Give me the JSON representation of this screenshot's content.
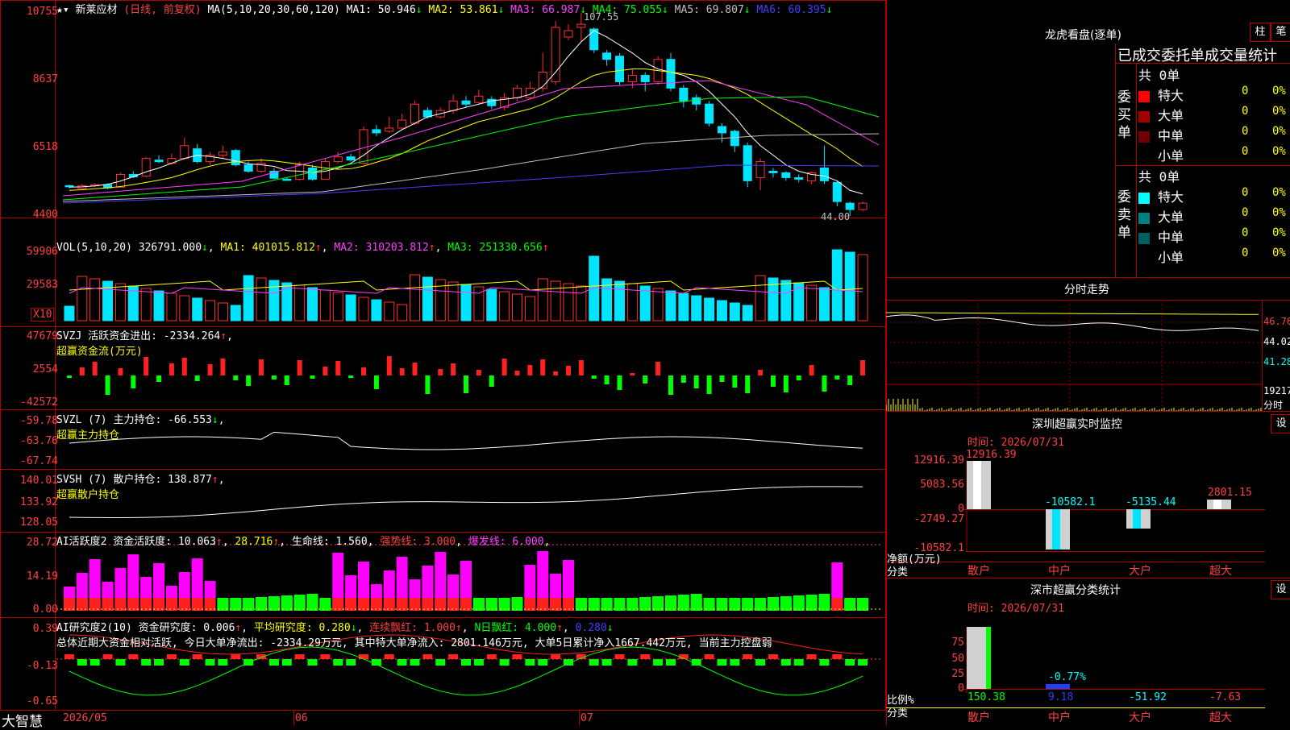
{
  "header": {
    "stock_name": "新莱应材",
    "period": "(日线, 前复权)",
    "ma_params": "MA(5,10,20,30,60,120)",
    "ma": [
      {
        "label": "MA1:",
        "value": "50.946",
        "arrow": "↓",
        "color": "#ffffff"
      },
      {
        "label": "MA2:",
        "value": "53.861",
        "arrow": "↓",
        "color": "#ffff00"
      },
      {
        "label": "MA3:",
        "value": "66.987",
        "arrow": "↓",
        "color": "#ff40ff"
      },
      {
        "label": "MA4:",
        "value": "75.055",
        "arrow": "↓",
        "color": "#00ff00"
      },
      {
        "label": "MA5:",
        "value": "69.807",
        "arrow": "↓",
        "color": "#c0c0c0"
      },
      {
        "label": "MA6:",
        "value": "60.395",
        "arrow": "↓",
        "color": "#4040ff"
      }
    ],
    "high_mark": "107.55",
    "low_mark": "44.00",
    "y_axis": [
      "10755",
      "8637",
      "6518",
      "4400"
    ]
  },
  "vol": {
    "title": "VOL(5,10,20)",
    "value": "326791.000",
    "ma1": "MA1: 401015.812",
    "ma2": "MA2: 310203.812",
    "ma3": "MA3: 251330.656",
    "y_axis": [
      "59906",
      "29583"
    ],
    "unit": "X10"
  },
  "svzj": {
    "title": "SVZJ  活跃资金进出: -2334.264",
    "subtitle": "超赢资金流(万元)",
    "y_axis": [
      "47679",
      "2554",
      "-42572"
    ]
  },
  "svzl": {
    "title": "SVZL (7) 主力持仓: -66.553",
    "subtitle": "超赢主力持仓",
    "y_axis": [
      "-59.78",
      "-63.76",
      "-67.74"
    ]
  },
  "svsh": {
    "title": "SVSH (7) 散户持仓: 138.877",
    "subtitle": "超赢散户持仓",
    "y_axis": [
      "140.01",
      "133.92",
      "128.05"
    ]
  },
  "ai_active": {
    "title": "AI活跃度2 资金活跃度: 10.063",
    "v2": "28.716",
    "life": "生命线: 1.560",
    "strong": "强势线: 3.000",
    "burst": "爆发线: 6.000",
    "y_axis": [
      "28.72",
      "14.19",
      "0.00"
    ]
  },
  "ai_research": {
    "title": "AI研究度2(10) 资金研究度: 0.006",
    "avg": "平均研究度: 0.280",
    "cont": "连续飘红: 1.000",
    "nday": "N日飘红: 4.000",
    "last": "0.280",
    "summary": "总体近期大资金相对活跃, 今日大单净流出: -2334.29万元, 其中特大单净流入: 2801.146万元, 大单5日累计净入1667.442万元, 当前主力控盘弱",
    "y_axis": [
      "0.39",
      "-0.13",
      "-0.65"
    ]
  },
  "bottom_axis": {
    "brand": "大智慧",
    "d1": "2026/05",
    "d2": "06",
    "d3": "07"
  },
  "right": {
    "top_title": "龙虎看盘(逐单)",
    "btn_bar": "柱",
    "btn_pen": "笔",
    "stat_title": "已成交委托单成交量统计",
    "buy_label": "委买单",
    "sell_label": "委卖单",
    "buy_total": "共 0单",
    "sell_total": "共 0单",
    "buy_rows": [
      {
        "name": "特大",
        "count": "0",
        "pct": "0%",
        "color": "#ff0000"
      },
      {
        "name": "大单",
        "count": "0",
        "pct": "0%",
        "color": "#a00000"
      },
      {
        "name": "中单",
        "count": "0",
        "pct": "0%",
        "color": "#700000"
      },
      {
        "name": "小单",
        "count": "0",
        "pct": "0%",
        "color": ""
      }
    ],
    "sell_rows": [
      {
        "name": "特大",
        "count": "0",
        "pct": "0%",
        "color": "#00ffff"
      },
      {
        "name": "大单",
        "count": "0",
        "pct": "0%",
        "color": "#008080"
      },
      {
        "name": "中单",
        "count": "0",
        "pct": "0%",
        "color": "#006060"
      },
      {
        "name": "小单",
        "count": "0",
        "pct": "0%",
        "color": ""
      }
    ],
    "intraday_title": "分时走势",
    "intraday_labels": [
      "46.76",
      "44.02",
      "41.28",
      "19217",
      "分时"
    ],
    "sz_title": "深圳超赢实时监控",
    "sz_time": "时间: 2026/07/31",
    "sz_y": [
      "12916.39",
      "5083.56",
      "0",
      "-2749.27",
      "-10582.1"
    ],
    "sz_values": [
      "12916.39",
      "-10582.1",
      "-5135.44",
      "2801.15"
    ],
    "sz_unit": "净额(万元)",
    "sz_cat": "分类",
    "categories": [
      "散户",
      "中户",
      "大户",
      "超大"
    ],
    "set_btn": "设",
    "cls_title": "深市超赢分类统计",
    "cls_time": "时间: 2026/07/31",
    "cls_y": [
      "75",
      "50",
      "25",
      "0"
    ],
    "cls_values": [
      "150.38",
      "9.18",
      "-51.92",
      "-7.63"
    ],
    "cls_note": "-0.77%",
    "cls_unit": "比例%",
    "cls_cat": "分类"
  },
  "chart_data": {
    "type": "candlestick",
    "candles": [
      [
        53.5,
        53.2,
        53.8,
        52.6
      ],
      [
        52.6,
        53.5,
        54.0,
        52.4
      ],
      [
        53.5,
        53.8,
        54.3,
        53.0
      ],
      [
        53.8,
        52.8,
        54.2,
        52.3
      ],
      [
        53.0,
        57.0,
        57.5,
        52.8
      ],
      [
        57.0,
        56.2,
        58.0,
        55.8
      ],
      [
        56.5,
        62.0,
        62.5,
        56.0
      ],
      [
        61.5,
        61.0,
        63.0,
        60.5
      ],
      [
        60.5,
        62.0,
        63.5,
        60.0
      ],
      [
        62.0,
        66.0,
        68.5,
        61.5
      ],
      [
        65.0,
        61.0,
        66.5,
        60.5
      ],
      [
        61.0,
        63.0,
        64.0,
        60.0
      ],
      [
        63.0,
        64.0,
        66.0,
        62.0
      ],
      [
        64.5,
        60.0,
        65.0,
        59.5
      ],
      [
        60.0,
        58.0,
        61.0,
        57.5
      ],
      [
        58.0,
        60.5,
        62.0,
        57.5
      ],
      [
        58.0,
        55.8,
        59.0,
        55.5
      ],
      [
        55.5,
        55.4,
        56.0,
        55.0
      ],
      [
        55.5,
        60.0,
        61.0,
        55.0
      ],
      [
        59.0,
        55.5,
        60.0,
        55.0
      ],
      [
        55.5,
        61.0,
        62.0,
        55.5
      ],
      [
        61.0,
        62.5,
        64.0,
        60.5
      ],
      [
        62.5,
        61.5,
        63.5,
        61.0
      ],
      [
        60.5,
        71.0,
        72.0,
        60.0
      ],
      [
        71.0,
        70.0,
        72.5,
        69.0
      ],
      [
        70.5,
        71.5,
        75.0,
        70.0
      ],
      [
        71.5,
        74.0,
        76.0,
        71.0
      ],
      [
        73.0,
        79.0,
        80.0,
        72.5
      ],
      [
        77.0,
        75.0,
        78.0,
        74.5
      ],
      [
        75.0,
        77.0,
        78.0,
        74.5
      ],
      [
        77.0,
        80.0,
        82.0,
        76.0
      ],
      [
        80.0,
        79.0,
        81.5,
        78.0
      ],
      [
        79.5,
        81.5,
        83.5,
        79.0
      ],
      [
        80.5,
        78.5,
        81.5,
        77.5
      ],
      [
        78.0,
        81.0,
        82.5,
        77.0
      ],
      [
        81.0,
        84.0,
        85.0,
        80.0
      ],
      [
        81.0,
        84.0,
        86.0,
        80.5
      ],
      [
        84.0,
        89.0,
        95.0,
        83.0
      ],
      [
        86.0,
        103.0,
        105.0,
        85.0
      ],
      [
        100.0,
        102.0,
        104.0,
        99.0
      ],
      [
        103.0,
        104.0,
        107.55,
        98.5
      ],
      [
        102.5,
        96.0,
        103.0,
        95.0
      ],
      [
        95.0,
        93.0,
        96.0,
        91.0
      ],
      [
        94.0,
        86.0,
        95.0,
        85.0
      ],
      [
        86.0,
        88.0,
        90.0,
        84.0
      ],
      [
        88.0,
        86.0,
        89.0,
        83.0
      ],
      [
        86.0,
        93.0,
        94.0,
        85.0
      ],
      [
        93.0,
        84.0,
        95.0,
        83.0
      ],
      [
        84.0,
        80.0,
        85.0,
        78.0
      ],
      [
        81.0,
        79.0,
        82.0,
        77.0
      ],
      [
        79.0,
        73.0,
        80.0,
        72.0
      ],
      [
        72.0,
        70.0,
        73.0,
        67.0
      ],
      [
        70.5,
        66.0,
        71.0,
        64.0
      ],
      [
        66.0,
        55.0,
        67.0,
        53.0
      ],
      [
        56.0,
        61.0,
        62.0,
        52.0
      ],
      [
        58.0,
        57.5,
        59.0,
        56.0
      ],
      [
        57.5,
        56.0,
        58.0,
        55.0
      ],
      [
        56.0,
        55.5,
        57.0,
        54.5
      ],
      [
        55.0,
        57.5,
        58.0,
        54.0
      ],
      [
        59.0,
        55.0,
        66.0,
        54.0
      ],
      [
        54.5,
        48.5,
        55.0,
        47.0
      ],
      [
        48.0,
        46.0,
        48.5,
        44.0
      ],
      [
        46.0,
        48.0,
        48.5,
        45.5
      ]
    ],
    "ma": {
      "MA1": [
        53.0,
        53.1,
        53.4,
        53.9,
        54.9,
        56.3,
        57.8,
        59.0,
        60.5,
        62.0,
        63.0,
        62.6,
        62.0,
        61.2,
        60.3,
        60.0,
        59.5,
        58.2,
        58.0,
        57.6,
        58.0,
        59.0,
        60.5,
        63.0,
        66.0,
        68.5,
        71.0,
        73.0,
        75.0,
        76.0,
        77.0,
        78.0,
        79.0,
        80.0,
        80.5,
        81.0,
        82.0,
        84.5,
        89.0,
        94.0,
        98.5,
        102.0,
        100.0,
        97.5,
        95.0,
        92.0,
        90.0,
        89.0,
        88.0,
        86.0,
        83.0,
        79.0,
        75.0,
        70.0,
        66.0,
        63.0,
        60.0,
        58.0,
        57.0,
        56.5,
        55.0,
        52.0,
        50.9
      ],
      "MA2": [
        52.0,
        52.2,
        52.5,
        52.8,
        53.2,
        53.8,
        54.5,
        55.2,
        56.0,
        57.2,
        58.5,
        59.6,
        60.5,
        61.0,
        61.3,
        61.5,
        61.2,
        60.7,
        60.2,
        59.6,
        59.0,
        58.6,
        58.8,
        59.6,
        60.8,
        62.0,
        63.5,
        65.5,
        67.5,
        69.0,
        70.5,
        72.0,
        73.5,
        74.5,
        75.5,
        76.5,
        77.5,
        79.0,
        81.0,
        83.5,
        86.0,
        88.0,
        89.0,
        89.5,
        90.0,
        90.0,
        89.5,
        89.0,
        88.5,
        88.0,
        87.0,
        85.5,
        84.0,
        82.0,
        79.5,
        77.0,
        74.5,
        72.0,
        69.5,
        67.5,
        65.0,
        62.0,
        59.5
      ]
    }
  }
}
